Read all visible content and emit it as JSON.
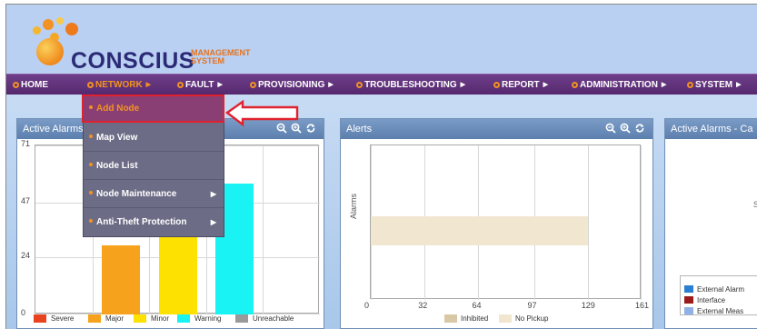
{
  "app": {
    "logo_name": "CONSCIUS",
    "logo_sub_line1": "MANAGEMENT",
    "logo_sub_line2": "SYSTEM",
    "brand_colors": {
      "nav_purple": "#5e2f79",
      "accent_orange": "#f29222",
      "header_blue": "#b9d0f2"
    }
  },
  "nav": {
    "items": [
      {
        "label": "HOME",
        "caret": ""
      },
      {
        "label": "NETWORK",
        "caret": "▶"
      },
      {
        "label": "FAULT",
        "caret": "▶"
      },
      {
        "label": "PROVISIONING",
        "caret": "▶"
      },
      {
        "label": "TROUBLESHOOTING",
        "caret": "▶"
      },
      {
        "label": "REPORT",
        "caret": "▶"
      },
      {
        "label": "ADMINISTRATION",
        "caret": "▶"
      },
      {
        "label": "SYSTEM",
        "caret": "▶"
      }
    ],
    "active": "NETWORK"
  },
  "network_menu": {
    "items": [
      {
        "label": "Add Node",
        "caret": ""
      },
      {
        "label": "Map View",
        "caret": ""
      },
      {
        "label": "Node List",
        "caret": ""
      },
      {
        "label": "Node Maintenance",
        "caret": "▶"
      },
      {
        "label": "Anti-Theft Protection",
        "caret": "▶"
      }
    ],
    "highlighted": "Add Node"
  },
  "panels": {
    "active_alarms": {
      "title": "Active Alarms",
      "y_ticks": [
        "0",
        "24",
        "47",
        "71"
      ],
      "legend": [
        {
          "label": "Severe",
          "color": "#e8431f"
        },
        {
          "label": "Major",
          "color": "#f7a21c"
        },
        {
          "label": "Minor",
          "color": "#fde100"
        },
        {
          "label": "Warning",
          "color": "#19f3f3"
        },
        {
          "label": "Unreachable",
          "color": "#9a9a9a"
        }
      ]
    },
    "alerts": {
      "title": "Alerts",
      "y_axis_label": "Alarms",
      "x_ticks": [
        "0",
        "32",
        "64",
        "97",
        "129",
        "161"
      ],
      "legend": [
        {
          "label": "Inhibited",
          "color": "#d8c8a6"
        },
        {
          "label": "No Pickup",
          "color": "#f1e6cf"
        }
      ]
    },
    "active_alarms_category": {
      "title": "Active Alarms - Ca",
      "axis_glyph": "S",
      "legend": [
        {
          "label": "External Alarm",
          "color": "#2a7fd4"
        },
        {
          "label": "Interface",
          "color": "#9a1b1b"
        },
        {
          "label": "External Meas",
          "color": "#8fb1e8"
        }
      ]
    }
  },
  "chart_data": [
    {
      "type": "bar",
      "title": "Active Alarms",
      "categories": [
        "Severe",
        "Major",
        "Minor",
        "Warning",
        "Unreachable"
      ],
      "values": [
        0,
        29,
        42,
        55,
        0
      ],
      "ylim": [
        0,
        71
      ],
      "y_ticks": [
        0,
        24,
        47,
        71
      ],
      "colors": [
        "#e8431f",
        "#f7a21c",
        "#fde100",
        "#19f3f3",
        "#9a9a9a"
      ],
      "grid": true,
      "legend_position": "bottom"
    },
    {
      "type": "bar",
      "orientation": "horizontal",
      "title": "Alerts",
      "ylabel": "Alarms",
      "series": [
        {
          "name": "Inhibited",
          "values": [
            0
          ]
        },
        {
          "name": "No Pickup",
          "values": [
            129
          ]
        }
      ],
      "xlim": [
        0,
        161
      ],
      "x_ticks": [
        0,
        32,
        64,
        97,
        129,
        161
      ],
      "colors": [
        "#d8c8a6",
        "#f1e6cf"
      ],
      "grid": true,
      "legend_position": "bottom"
    }
  ]
}
